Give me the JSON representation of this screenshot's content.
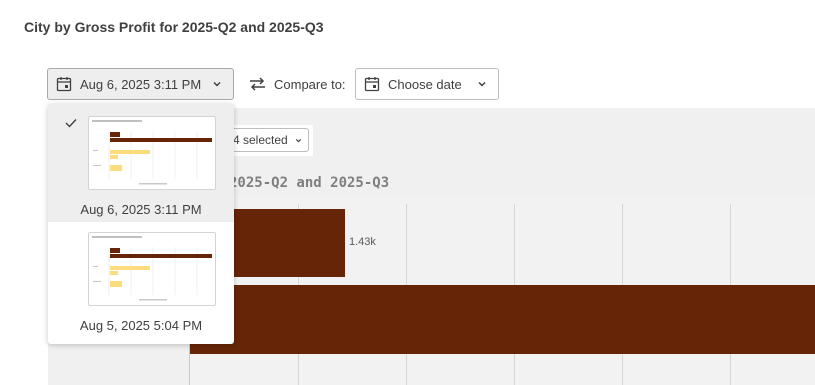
{
  "title": "City by Gross Profit for 2025-Q2 and 2025-Q3",
  "toolbar": {
    "selected_snapshot": "Aug 6, 2025 3:11 PM",
    "compare_label": "Compare to:",
    "choose_date": "Choose date"
  },
  "snapshots": [
    {
      "label": "Aug 6, 2025 3:11 PM",
      "selected": true
    },
    {
      "label": "Aug 5, 2025 5:04 PM",
      "selected": false
    }
  ],
  "background_chart": {
    "title_visible": "2025-Q2 and 2025-Q3",
    "filter_label": "4 selected",
    "value_label": "1.43k",
    "bar_color": "#662506"
  },
  "colors": {
    "bar": "#662506",
    "thumb_light_bar": "#fddc80",
    "selected_bg": "#eeeeee"
  },
  "icons": [
    "calendar-icon",
    "chevron-down-icon",
    "swap-icon",
    "checkmark-icon"
  ]
}
